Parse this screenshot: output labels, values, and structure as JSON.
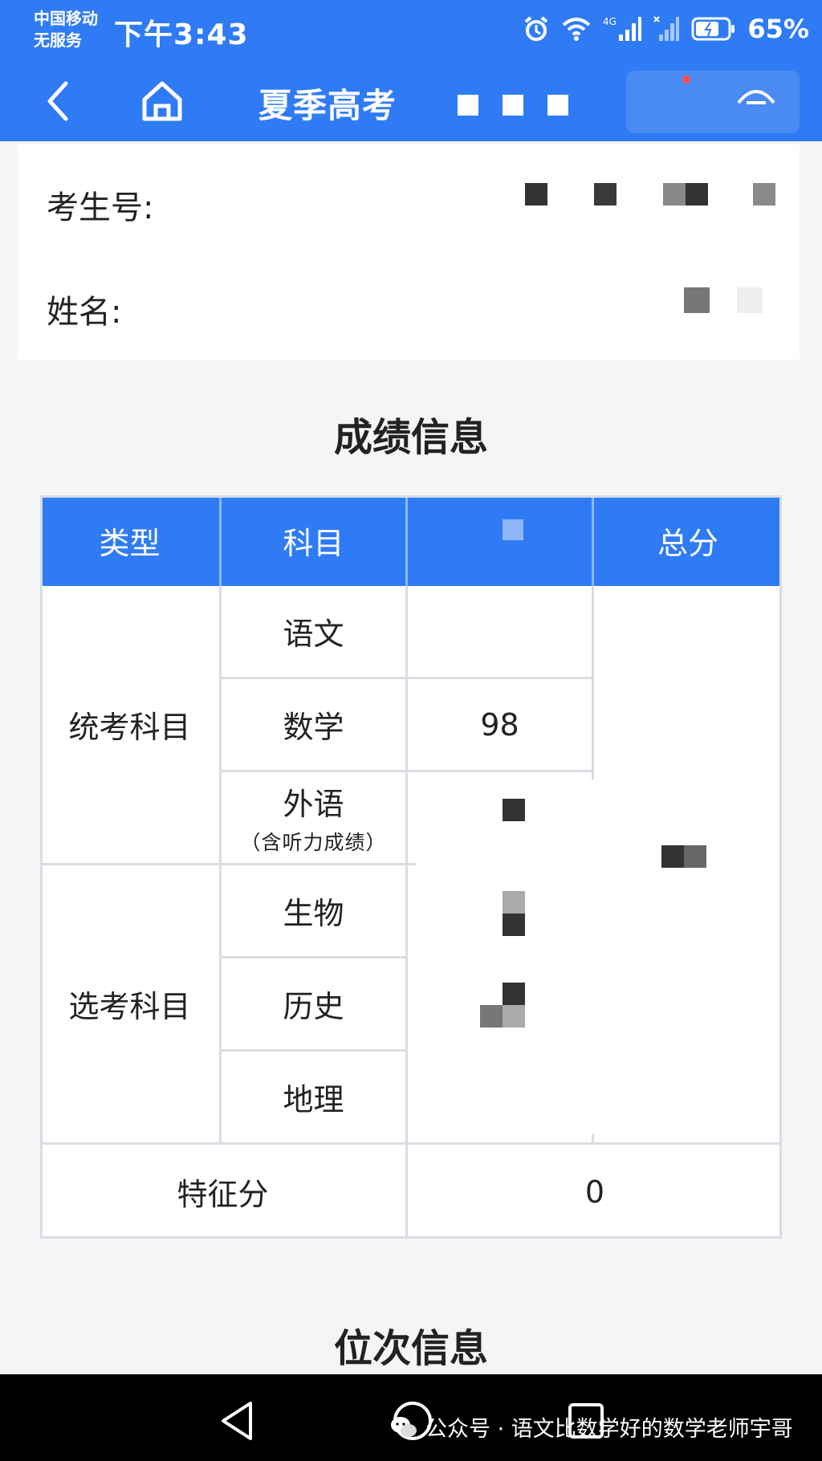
{
  "status_bar": {
    "carrier_line1": "中国移动",
    "carrier_line2": "无服务",
    "time": "下午3:43",
    "network": "4G",
    "battery": "65%"
  },
  "nav": {
    "title": "夏季高考",
    "icons": [
      "back-arrow-icon",
      "home-icon",
      "menu-icon"
    ]
  },
  "student_info": {
    "exam_id_label": "考生号:",
    "name_label": "姓名:"
  },
  "sections": {
    "scores_title": "成绩信息",
    "rank_title": "位次信息"
  },
  "score_table": {
    "headers": [
      "类型",
      "科目",
      "",
      "总分"
    ],
    "groups": {
      "unified": "统考科目",
      "elective": "选考科目"
    },
    "subjects": [
      "语文",
      "数学",
      "外语",
      "生物",
      "历史",
      "地理"
    ],
    "foreign_note": "（含听力成绩）",
    "math_score": "98",
    "feature_label": "特征分",
    "feature_score": "0"
  },
  "watermark": "公众号 · 语文比数学好的数学老师宇哥",
  "colors": {
    "primary": "#2f7bf5",
    "border": "#d9dde3"
  }
}
